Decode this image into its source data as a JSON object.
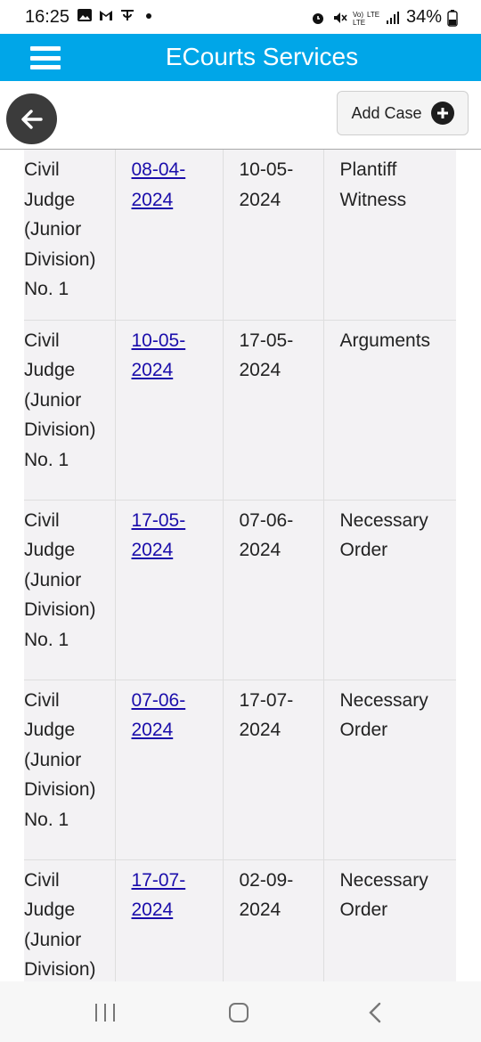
{
  "status_bar": {
    "time": "16:25",
    "battery": "34%",
    "network": "Vo) LTE LTE+"
  },
  "header": {
    "title": "ECourts Services"
  },
  "toolbar": {
    "add_case_label": "Add Case"
  },
  "rows": [
    {
      "court_lines": [
        "Civil",
        "Judge",
        "(Junior",
        "Division)",
        "No. 1"
      ],
      "business_date_lines": [
        "08-04-",
        "2024"
      ],
      "hearing_date_lines": [
        "10-05-",
        "2024"
      ],
      "purpose_lines": [
        "Plantiff",
        "Witness"
      ]
    },
    {
      "court_lines": [
        "Civil",
        "Judge",
        "(Junior",
        "Division)",
        "No. 1"
      ],
      "business_date_lines": [
        "10-05-",
        "2024"
      ],
      "hearing_date_lines": [
        "17-05-",
        "2024"
      ],
      "purpose_lines": [
        "Arguments"
      ]
    },
    {
      "court_lines": [
        "Civil",
        "Judge",
        "(Junior",
        "Division)",
        "No. 1"
      ],
      "business_date_lines": [
        "17-05-",
        "2024"
      ],
      "hearing_date_lines": [
        "07-06-",
        "2024"
      ],
      "purpose_lines": [
        "Necessary",
        "Order"
      ]
    },
    {
      "court_lines": [
        "Civil",
        "Judge",
        "(Junior",
        "Division)",
        "No. 1"
      ],
      "business_date_lines": [
        "07-06-",
        "2024"
      ],
      "hearing_date_lines": [
        "17-07-",
        "2024"
      ],
      "purpose_lines": [
        "Necessary",
        "Order"
      ]
    },
    {
      "court_lines": [
        "Civil",
        "Judge",
        "(Junior",
        "Division)"
      ],
      "business_date_lines": [
        "17-07-",
        "2024"
      ],
      "hearing_date_lines": [
        "02-09-",
        "2024"
      ],
      "purpose_lines": [
        "Necessary",
        "Order"
      ]
    }
  ],
  "colors": {
    "header_bg": "#00a6e8",
    "link": "#1a0dab",
    "table_bg": "#f3f2f4"
  }
}
